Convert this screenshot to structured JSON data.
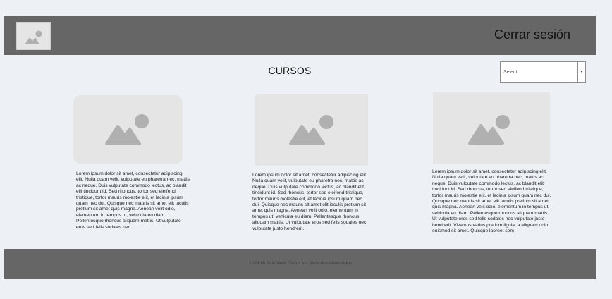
{
  "header": {
    "logo_icon": "image-placeholder-icon",
    "logout_label": "Cerrar sesión"
  },
  "main": {
    "title": "CURSOS",
    "filter": {
      "selected": "Select"
    },
    "cards": [
      {
        "image_icon": "image-placeholder-icon",
        "text": "Lorem ipsum dolor sit amet, consectetur adipiscing elit. Nulla quam velit, vulputate eu pharetra nec, mattis ac neque. Duis vulputate commodo lectus, ac blandit elit tincidunt id. Sed rhoncus, tortor sed eleifend tristique, tortor mauris molestie elit, et lacinia ipsum quam nec dui. Quisque nec mauris sit amet elit iaculis pretium sit amet quis magna. Aenean velit odio, elementum in tempus ut, vehicula eu diam. Pellentesque rhoncus aliquam mattis. Ut vulputate eros sed felis sodales nec"
      },
      {
        "image_icon": "image-placeholder-icon",
        "text": "Lorem ipsum dolor sit amet, consectetur adipiscing elit. Nulla quam velit, vulputate eu pharetra nec, mattis ac neque. Duis vulputate commodo lectus, ac blandit elit tincidunt id. Sed rhoncus, tortor sed eleifend tristique, tortor mauris molestie elit, et lacinia ipsum quam nec dui. Quisque nec mauris sit amet elit iaculis pretium sit amet quis magna. Aenean velit odio, elementum in tempus ut, vehicula eu diam. Pellentesque rhoncus aliquam mattis. Ut vulputate eros sed felis sodales nec vulputate justo hendrerit."
      },
      {
        "image_icon": "image-placeholder-icon",
        "text": "Lorem ipsum dolor sit amet, consectetur adipiscing elit. Nulla quam velit, vulputate eu pharetra nec, mattis ac neque. Duis vulputate commodo lectus, ac blandit elit tincidunt id. Sed rhoncus, tortor sed eleifend tristique, tortor mauris molestie elit, et lacinia ipsum quam nec dui. Quisque nec mauris sit amet elit iaculis pretium sit amet quis magna. Aenean velit odio, elementum in tempus ut, vehicula eu diam. Pellentesque rhoncus aliquam mattis. Ut vulputate eros sed felis sodales nec vulputate justo hendrerit. Vivamus varius pretium ligula, a aliquam odio euismod sit amet. Quisque laoreet sem"
      }
    ]
  },
  "footer": {
    "text": "2024 Mi Sitio Web. Todos los derechos reservados"
  }
}
